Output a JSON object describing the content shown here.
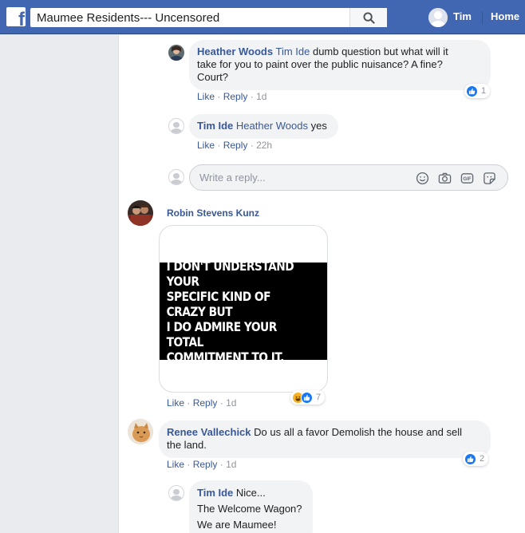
{
  "header": {
    "search_value": "Maumee Residents--- Uncensored",
    "user_name": "Tim",
    "home_label": "Home",
    "brand_color": "#4267b2"
  },
  "comments": [
    {
      "author": "Heather Woods",
      "tag": "Tim Ide",
      "line1": " dumb question but what will it",
      "line2": "take for you to paint over the public nuisance? A fine?",
      "line3": "Court?",
      "like": "Like",
      "reply": "Reply",
      "time": "1d",
      "reaction_count": "1"
    },
    {
      "author": "Tim Ide",
      "tag": "Heather Woods",
      "text": " yes",
      "like": "Like",
      "reply": "Reply",
      "time": "22h"
    },
    {
      "author": "Robin Stevens Kunz",
      "meme_line1": "I DON'T UNDERSTAND YOUR",
      "meme_line2": "SPECIFIC KIND OF CRAZY BUT",
      "meme_line3": "I DO ADMIRE YOUR TOTAL",
      "meme_line4": "COMMITMENT TO IT.",
      "like": "Like",
      "reply": "Reply",
      "time": "1d",
      "reaction_count": "7"
    },
    {
      "author": "Renee Vallechick",
      "line1": " Do us all a favor Demolish the house and sell",
      "line2": "the land.",
      "like": "Like",
      "reply": "Reply",
      "time": "1d",
      "reaction_count": "2"
    },
    {
      "author": "Tim Ide",
      "text": " Nice...",
      "line2": "The Welcome Wagon?",
      "line3": "We are Maumee!"
    }
  ],
  "reply_box": {
    "placeholder": "Write a reply..."
  },
  "icons": {
    "search": "search-icon",
    "emoji": "emoji-icon",
    "camera": "camera-icon",
    "gif": "gif-icon",
    "sticker": "sticker-icon",
    "like": "like-reaction-icon",
    "haha": "haha-reaction-icon"
  }
}
